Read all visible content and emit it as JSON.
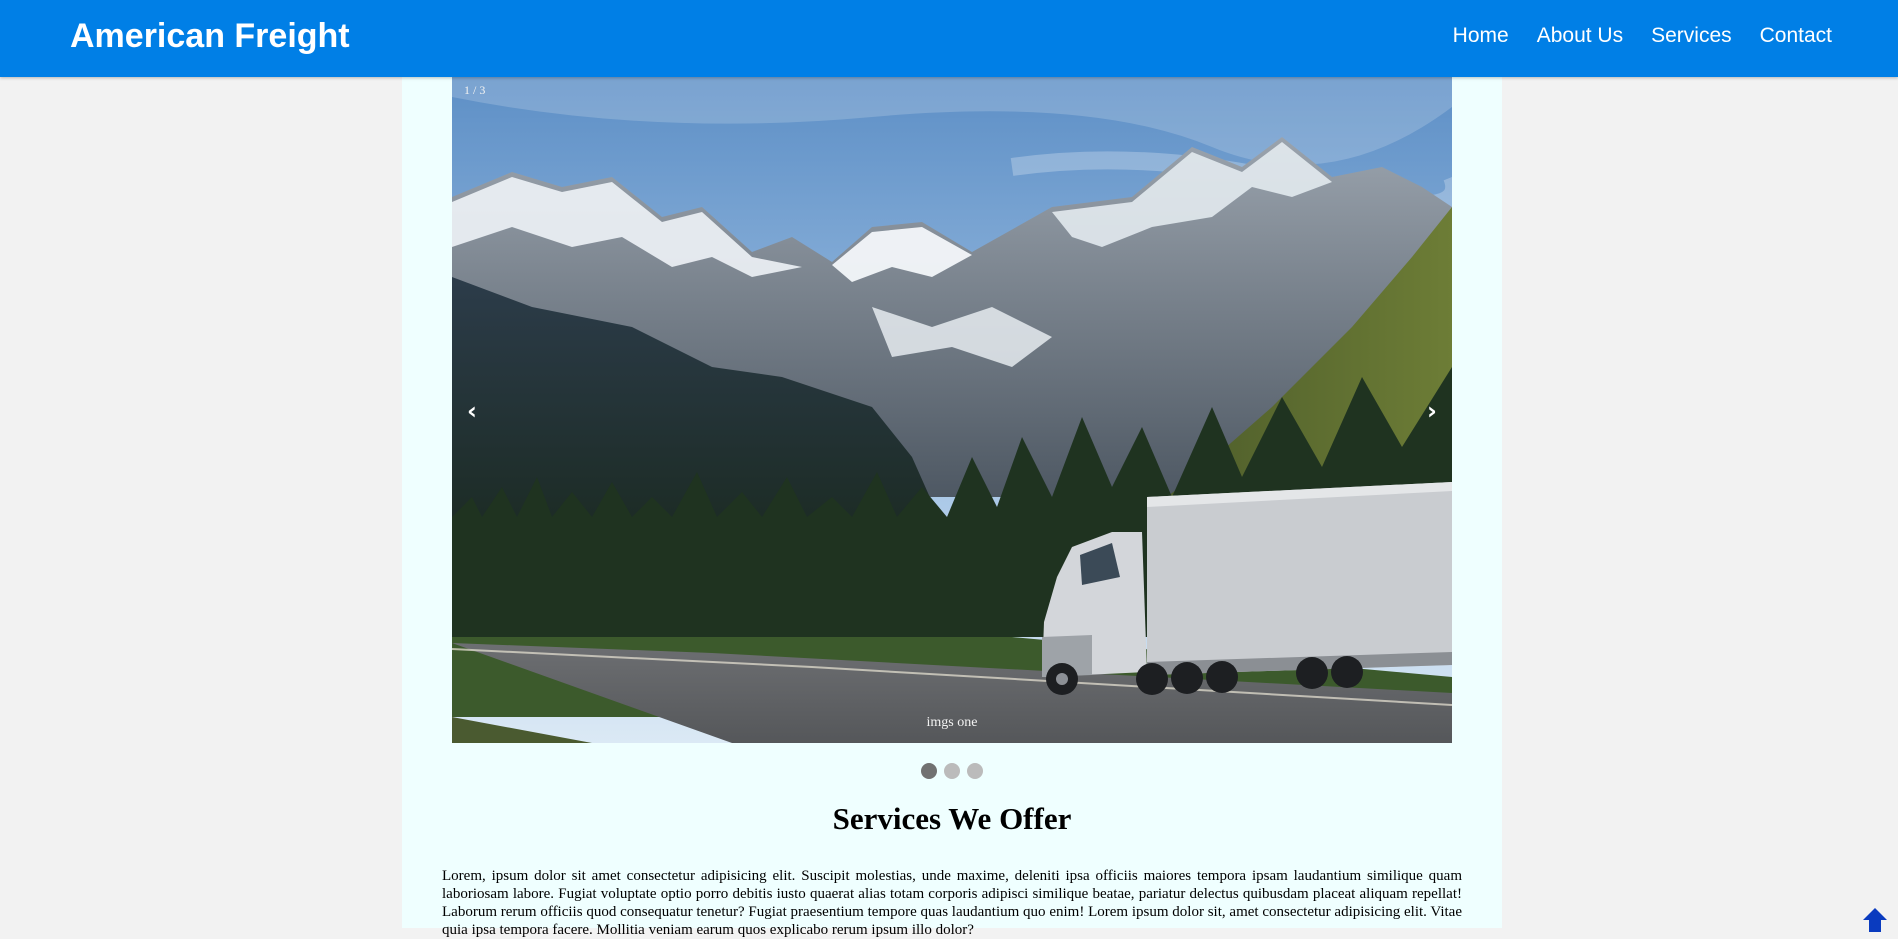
{
  "header": {
    "brand": "American Freight",
    "nav": [
      {
        "label": "Home"
      },
      {
        "label": "About Us"
      },
      {
        "label": "Services"
      },
      {
        "label": "Contact"
      }
    ],
    "bg_color": "#007fe6"
  },
  "slideshow": {
    "number_text": "1 / 3",
    "caption": "imgs one",
    "prev_label": "‹",
    "next_label": "›",
    "slide_count": 3,
    "active_slide": 1
  },
  "services": {
    "title": "Services We Offer",
    "text": "Lorem, ipsum dolor sit amet consectetur adipisicing elit. Suscipit molestias, unde maxime, deleniti ipsa officiis maiores tempora ipsam laudantium similique quam laboriosam labore. Fugiat voluptate optio porro debitis iusto quaerat alias totam corporis adipisci similique beatae, pariatur delectus quibusdam placeat aliquam repellat! Laborum rerum officiis quod consequatur tenetur? Fugiat praesentium tempore quas laudantium quo enim! Lorem ipsum dolor sit, amet consectetur adipisicing elit. Vitae quia ipsa tempora facere. Mollitia veniam earum quos explicabo rerum ipsum illo dolor?"
  },
  "icons": {
    "back_to_top": "arrow-up-icon"
  }
}
